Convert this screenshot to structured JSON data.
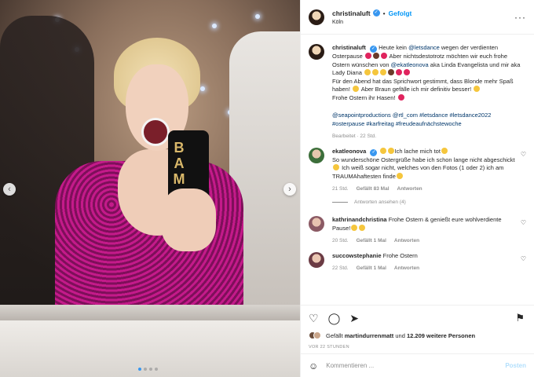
{
  "header": {
    "username": "christinaluft",
    "verified_mark": "✓",
    "separator": "•",
    "follow_label": "Gefolgt",
    "location": "Köln",
    "more": "···"
  },
  "media": {
    "phone_text": "B\nA\nM",
    "prev": "‹",
    "next": "›"
  },
  "caption": {
    "username": "christinaluft",
    "text_part1": "Heute kein ",
    "mention1": "@letsdance",
    "text_part2": " wegen der verdienten Osterpause ",
    "text_part3": " Aber nichtsdestotrotz möchten wir euch frohe Ostern wünschen von ",
    "mention2": "@ekatleonova",
    "text_part4": " aka Linda Evangelista und mir aka Lady Diana ",
    "text_part5": "Für den Abend hat das Sprichwort gestimmt, dass Blonde mehr Spaß haben! ",
    "text_part6": " Aber Braun gefälle ich mir definitiv besser! ",
    "text_part7": "Frohe Ostern ihr Hasen! ",
    "tags": "@seapointproductions @rtl_com #letsdance #letsdance2022 #osterpause #karfreitag #freudeaufnächstewoche",
    "meta": "Bearbeitet · 22 Std."
  },
  "comments": [
    {
      "username": "ekatleonova",
      "text_a": "Ich lache mich tot",
      "text_b": "So wunderschöne Ostergrüße habe ich schon lange nicht abgeschickt",
      "text_c": " Ich weiß sogar nicht, welches von den Fotos (1 oder 2) ich am TRAUMAhaftesten finde",
      "time": "21 Std.",
      "likes": "Gefällt 83 Mal",
      "reply": "Antworten",
      "view_replies": "Antworten ansehen (4)"
    },
    {
      "username": "kathrinandchristina",
      "text": "Frohe Ostern & genießt eure wohlverdiente Pause!",
      "time": "20 Std.",
      "likes": "Gefällt 1 Mal",
      "reply": "Antworten"
    },
    {
      "username": "succowstephanie",
      "text": "Frohe Ostern",
      "time": "22 Std.",
      "likes": "Gefällt 1 Mal",
      "reply": "Antworten"
    }
  ],
  "actions": {
    "like_icon": "♡",
    "comment_icon": "◯",
    "share_icon": "➤",
    "bookmark_icon": "⚑",
    "liked_prefix": "Gefällt ",
    "liked_user": "martindurrenmatt",
    "liked_mid": " und ",
    "liked_count": "12.209 weitere Personen",
    "time": "VOR 22 STUNDEN"
  },
  "add_comment": {
    "placeholder": "Kommentieren ...",
    "post_label": "Posten",
    "smile_icon": "☺"
  },
  "heart_icon": "♡",
  "colors": {
    "accent": "#0095f6",
    "link": "#00376b",
    "muted": "#8e8e8e"
  }
}
